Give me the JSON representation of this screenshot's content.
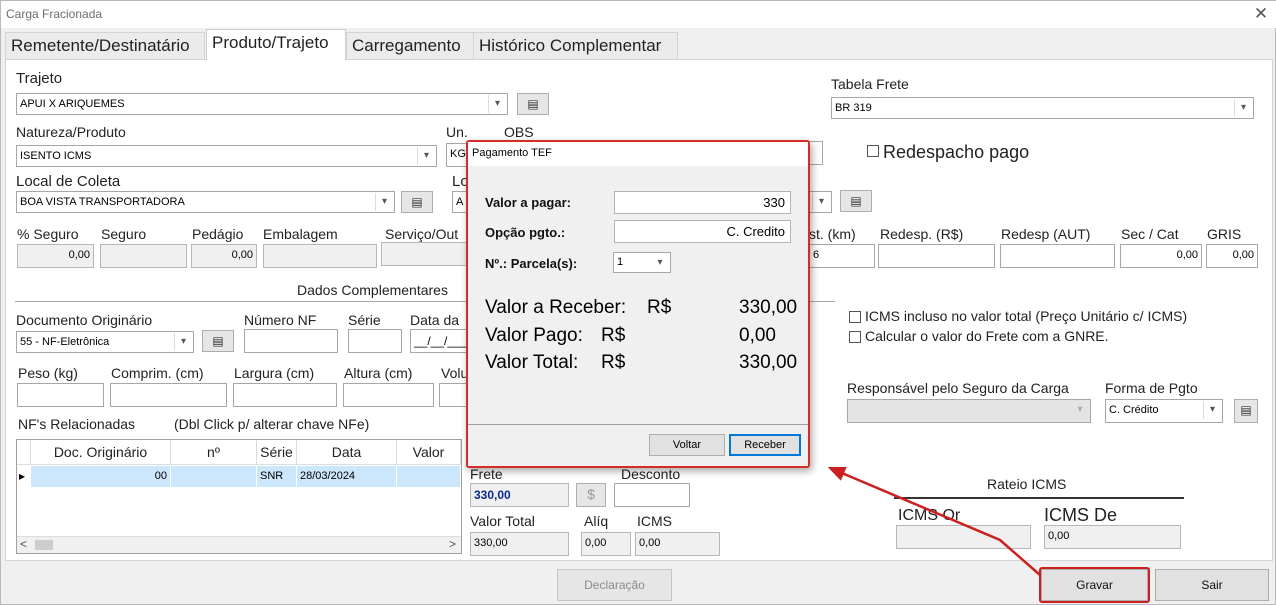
{
  "window": {
    "title": "Carga Fracionada",
    "close_glyph": "✕"
  },
  "tabs": [
    "Remetente/Destinatário",
    "Produto/Trajeto",
    "Carregamento",
    "Histórico Complementar"
  ],
  "trajeto": {
    "label": "Trajeto",
    "value": "APUI X ARIQUEMES"
  },
  "tabela_frete": {
    "label": "Tabela Frete",
    "value": "BR 319"
  },
  "natureza": {
    "label": "Natureza/Produto",
    "value": "ISENTO ICMS"
  },
  "un": {
    "label": "Un.",
    "value": "KG"
  },
  "obs": {
    "label": "OBS"
  },
  "redespacho_pago": "Redespacho  pago",
  "local_coleta": {
    "label": "Local de Coleta",
    "value": "BOA VISTA TRANSPORTADORA"
  },
  "local_entrega": {
    "label": "Lo",
    "value": "A"
  },
  "valores": {
    "perc_seguro": {
      "label": "% Seguro",
      "value": "0,00"
    },
    "seguro": {
      "label": "Seguro",
      "value": ""
    },
    "pedagio": {
      "label": "Pedágio",
      "value": "0,00"
    },
    "embalagem": {
      "label": "Embalagem",
      "value": ""
    },
    "servico": {
      "label": "Serviço/Out",
      "value": ""
    },
    "dist": {
      "label": "st. (km)",
      "value": "6"
    },
    "redesp_rs": {
      "label": "Redesp. (R$)",
      "value": ""
    },
    "redesp_aut": {
      "label": "Redesp (AUT)",
      "value": ""
    },
    "sec_cat": {
      "label": "Sec / Cat",
      "value": "0,00"
    },
    "gris": {
      "label": "GRIS",
      "value": "0,00"
    }
  },
  "dados_complementares": "Dados Complementares",
  "documento": {
    "label": "Documento Originário",
    "value": "55 - NF-Eletrônica"
  },
  "numero_nf": {
    "label": "Número NF"
  },
  "serie": {
    "label": "Série"
  },
  "data_emissao": {
    "label": "Data da",
    "value": "__/__/___"
  },
  "icms_incluso": "ICMS incluso no valor total (Preço Unitário c/ ICMS)",
  "calc_gnre": "Calcular o valor do Frete com a GNRE.",
  "medidas": {
    "peso": "Peso (kg)",
    "comprimento": "Comprim. (cm)",
    "largura": "Largura (cm)",
    "altura": "Altura (cm)",
    "volume": "Volu"
  },
  "responsavel_seguro": {
    "label": "Responsável pelo Seguro da Carga",
    "value": ""
  },
  "forma_pgto": {
    "label": "Forma de Pgto",
    "value": "C. Crédito"
  },
  "nfs": {
    "title": "NF's Relacionadas",
    "hint": "(Dbl Click p/ alterar chave NFe)",
    "columns": [
      "Doc. Originário",
      "nº",
      "Série",
      "Data",
      "Valor"
    ],
    "rows": [
      {
        "indicator": "▸",
        "doc": "00",
        "n": "",
        "serie": "SNR",
        "data": "28/03/2024",
        "valor": ""
      }
    ],
    "scroll_left": "<",
    "scroll_right": ">"
  },
  "frete": {
    "label": "Frete",
    "value": "330,00",
    "currency_button": "$"
  },
  "desconto": {
    "label": "Desconto",
    "value": ""
  },
  "valor_total": {
    "label": "Valor Total",
    "value": "330,00"
  },
  "aliq": {
    "label": "Alíq",
    "value": "0,00"
  },
  "icms": {
    "label": "ICMS",
    "value": "0,00"
  },
  "rateio": {
    "title": "Rateio ICMS",
    "icms_or": {
      "label": "ICMS Or",
      "value": ""
    },
    "icms_de": {
      "label": "ICMS De",
      "value": "0,00"
    }
  },
  "buttons": {
    "declaracao": "Declaração",
    "gravar": "Gravar",
    "sair": "Sair"
  },
  "dialog": {
    "title": "Pagamento TEF",
    "valor_pagar": {
      "label": "Valor a pagar:",
      "value": "330"
    },
    "opcao_pgto": {
      "label": "Opção pgto.:",
      "value": "C. Credito"
    },
    "parcelas": {
      "label": "Nº.: Parcela(s):",
      "value": "1"
    },
    "valor_receber": {
      "label": "Valor a Receber:",
      "currency": "R$",
      "value": "330,00"
    },
    "valor_pago": {
      "label": "Valor Pago:",
      "currency": "R$",
      "value": "0,00"
    },
    "valor_total": {
      "label": "Valor Total:",
      "currency": "R$",
      "value": "330,00"
    },
    "voltar": "Voltar",
    "receber": "Receber"
  },
  "icons": {
    "list": "list-icon",
    "dropdown": "chevron-down-icon",
    "close": "close-icon"
  },
  "colors": {
    "annotation": "#cc2020",
    "selection": "#cce6fb",
    "focus": "#0078d7"
  }
}
